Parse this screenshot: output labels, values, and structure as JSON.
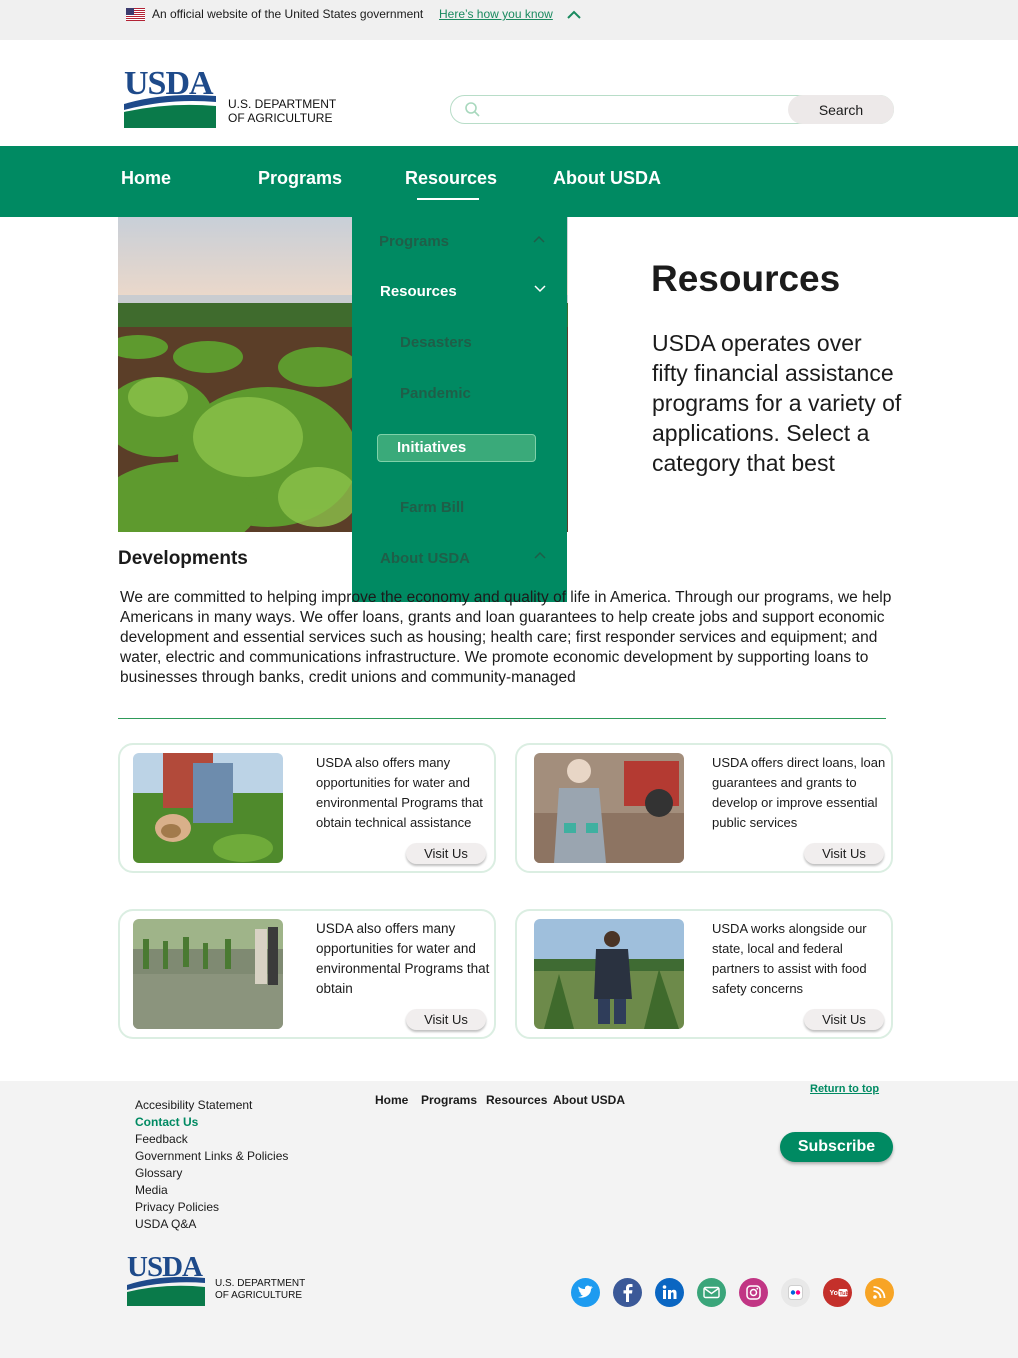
{
  "gov_banner": {
    "text": "An official website of the United States government",
    "link": "Here’s how you know"
  },
  "header": {
    "logo_text": "USDA",
    "dept_line1": "U.S. DEPARTMENT",
    "dept_line2": "OF AGRICULTURE",
    "search_placeholder": "",
    "search_button": "Search"
  },
  "nav": {
    "items": [
      {
        "label": "Home"
      },
      {
        "label": "Programs"
      },
      {
        "label": "Resources"
      },
      {
        "label": "About USDA"
      }
    ],
    "active": "Resources"
  },
  "dropdown": {
    "programs": "Programs",
    "resources": "Resources",
    "sub": [
      "Desasters",
      "Pandemic",
      "Initiatives",
      "Farm Bill"
    ],
    "about": "About USDA"
  },
  "hero": {
    "title": "Resources",
    "text": "USDA operates over fifty financial assistance programs for a variety of applications. Select a category that best"
  },
  "developments": {
    "title": "Developments",
    "text": "We are committed to helping improve the economy and quality of life in America. Through our programs, we help Americans in many ways. We offer loans, grants and loan guarantees to help create jobs and support economic development and essential services such as housing; health care; first responder services and equipment; and water, electric and communications infrastructure. We promote economic development by supporting loans to businesses through banks, credit unions and community-managed"
  },
  "cards": [
    {
      "text": "USDA also offers many opportunities for water and environmental Programs that obtain technical assistance",
      "button": "Visit Us"
    },
    {
      "text": "USDA offers direct loans, loan guarantees and grants to develop or improve essential public services",
      "button": "Visit Us"
    },
    {
      "text": "USDA also offers many opportunities for water and environmental Programs that obtain",
      "button": "Visit Us"
    },
    {
      "text": "USDA works alongside our state, local and federal partners to assist with food safety concerns",
      "button": "Visit Us"
    }
  ],
  "footer": {
    "links": [
      "Accesibility Statement",
      "Contact Us",
      "Feedback",
      "Government Links & Policies",
      "Glossary",
      "Media",
      "Privacy Policies",
      "USDA Q&A"
    ],
    "nav": [
      "Home",
      "Programs",
      "Resources",
      "About USDA"
    ],
    "return_top": "Return to top",
    "subscribe": "Subscribe",
    "logo_text": "USDA",
    "dept_line1": "U.S. DEPARTMENT",
    "dept_line2": "OF AGRICULTURE",
    "social": [
      {
        "icon": "twitter-icon",
        "color": "#1d9bf0"
      },
      {
        "icon": "facebook-icon",
        "color": "#3b5998"
      },
      {
        "icon": "linkedin-icon",
        "color": "#0a66c2"
      },
      {
        "icon": "email-icon",
        "color": "#3aa57a"
      },
      {
        "icon": "instagram-icon",
        "color": "#c13584"
      },
      {
        "icon": "flickr-icon",
        "color": "#e8e8e8"
      },
      {
        "icon": "youtube-icon",
        "color": "#c4302b"
      },
      {
        "icon": "rss-icon",
        "color": "#f7a425"
      }
    ]
  }
}
